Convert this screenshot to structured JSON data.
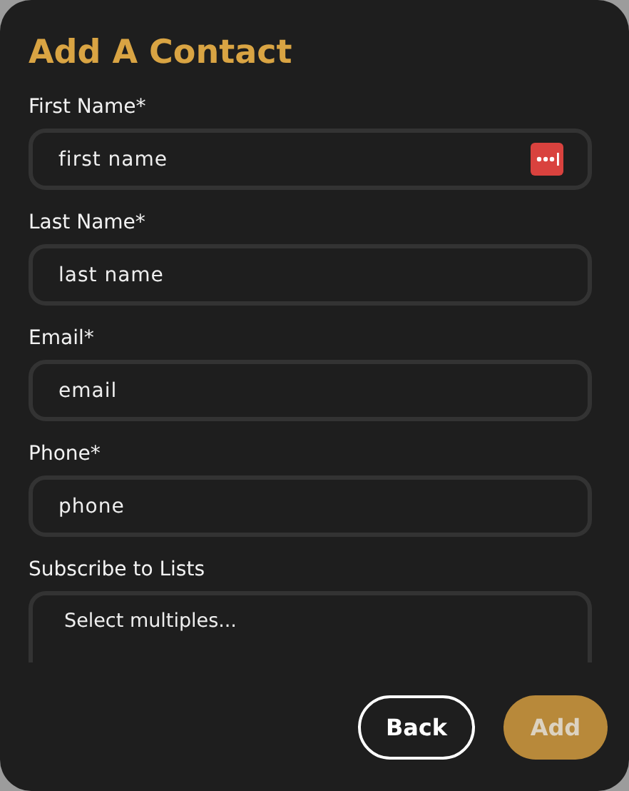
{
  "dialog": {
    "title": "Add A Contact"
  },
  "fields": [
    {
      "label": "First Name*",
      "kind": "text",
      "placeholder": "first name",
      "autofill_icon": true
    },
    {
      "label": "Last Name*",
      "kind": "text",
      "placeholder": "last name",
      "autofill_icon": false
    },
    {
      "label": "Email*",
      "kind": "text",
      "placeholder": "email",
      "autofill_icon": false
    },
    {
      "label": "Phone*",
      "kind": "text",
      "placeholder": "phone",
      "autofill_icon": false
    },
    {
      "label": "Subscribe to Lists",
      "kind": "select",
      "placeholder": "Select multiples..."
    }
  ],
  "buttons": [
    {
      "label": "Back",
      "kind": "outline",
      "disabled": false
    },
    {
      "label": "Add",
      "kind": "filled",
      "disabled": true
    }
  ]
}
